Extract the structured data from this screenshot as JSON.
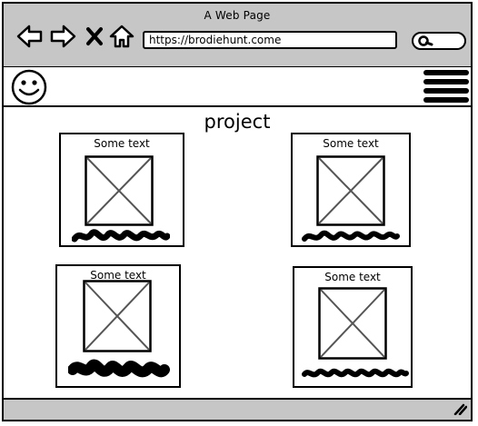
{
  "window": {
    "title": "A Web Page"
  },
  "toolbar": {
    "back_icon": "arrow-left-icon",
    "forward_icon": "arrow-right-icon",
    "stop_icon": "close-icon",
    "home_icon": "home-icon"
  },
  "address_bar": {
    "url": "https://brodiehunt.come"
  },
  "search": {
    "icon": "search-icon"
  },
  "header": {
    "logo_icon": "smiley-icon",
    "menu_icon": "hamburger-menu-icon"
  },
  "main": {
    "heading": "project",
    "cards": [
      {
        "caption": "Some text",
        "image_icon": "image-placeholder-icon"
      },
      {
        "caption": "Some text",
        "image_icon": "image-placeholder-icon"
      },
      {
        "caption": "Some text",
        "image_icon": "image-placeholder-icon"
      },
      {
        "caption": "Some text",
        "image_icon": "image-placeholder-icon"
      }
    ]
  },
  "footer": {
    "resize_icon": "resize-grip-icon"
  },
  "colors": {
    "chrome": "#c6c6c6",
    "ink": "#000000",
    "placeholder_x": "#555555"
  }
}
